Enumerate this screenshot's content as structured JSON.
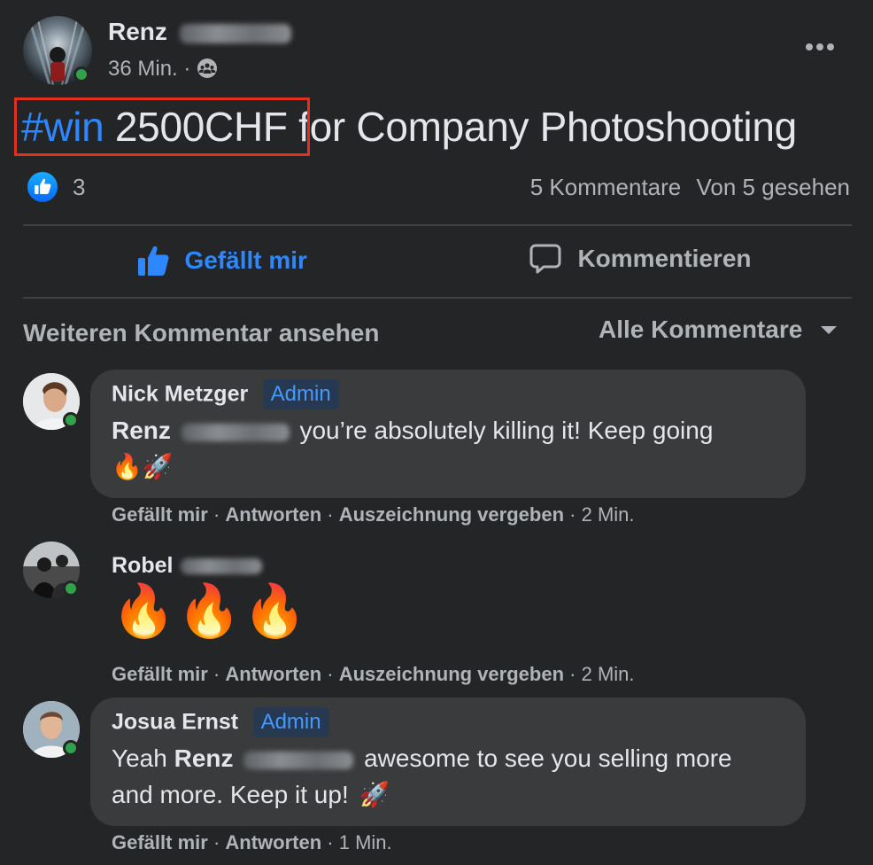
{
  "post": {
    "author": "Renz",
    "time": "36 Min.",
    "dot": "·",
    "hashtag": "#win",
    "amount": "2500CHF",
    "title_rest": "for Company Photoshooting",
    "likes_count": "3",
    "comments_count": "5 Kommentare",
    "seen": "Von 5 gesehen"
  },
  "actions": {
    "like": "Gefällt mir",
    "comment": "Kommentieren"
  },
  "comments_bar": {
    "more": "Weiteren Kommentar ansehen",
    "filter": "Alle Kommentare"
  },
  "comments": [
    {
      "name": "Nick Metzger",
      "badge": "Admin",
      "mention": "Renz",
      "text": "you’re absolutely killing it! Keep going",
      "emoji": "🔥🚀",
      "like": "Gefällt mir",
      "reply": "Antworten",
      "award": "Auszeichnung vergeben",
      "time": "2 Min."
    },
    {
      "name": "Robel",
      "emoji": "🔥🔥🔥",
      "like": "Gefällt mir",
      "reply": "Antworten",
      "award": "Auszeichnung vergeben",
      "time": "2 Min."
    },
    {
      "name": "Josua Ernst",
      "badge": "Admin",
      "prefix": "Yeah",
      "mention": "Renz",
      "text": "awesome to see you selling more",
      "text2": "and more. Keep it up!",
      "emoji": "🚀",
      "like": "Gefällt mir",
      "reply": "Antworten",
      "time": "1 Min."
    }
  ],
  "sep": "·",
  "colors": {
    "background": "#242526",
    "bubble": "#3a3b3c",
    "accent": "#2d88ff",
    "highlight_box": "#e0301e",
    "online": "#31a24c"
  },
  "icons": {
    "more": "more-horizontal-icon",
    "audience": "group-icon",
    "like_reaction": "like-reaction-icon",
    "like": "thumbs-up-icon",
    "comment": "comment-bubble-icon",
    "dropdown": "caret-down-icon"
  }
}
